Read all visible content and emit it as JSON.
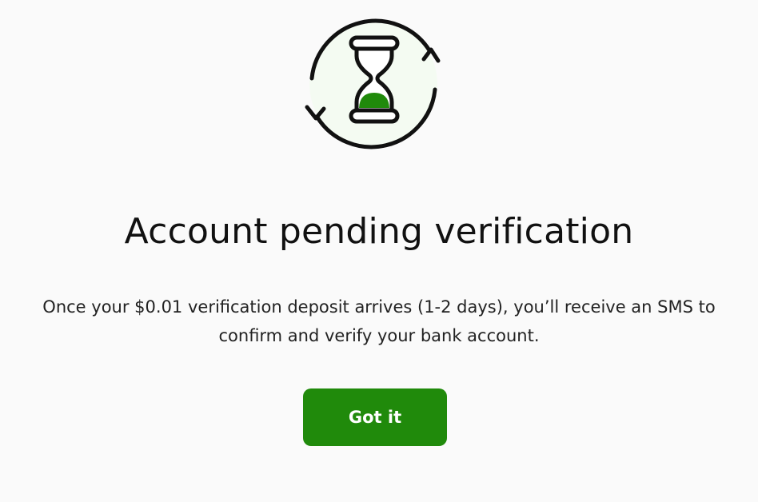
{
  "illustration": {
    "icon": "hourglass-refresh-icon",
    "accent_color": "#208a0b",
    "circle_fill": "#f4fbf2"
  },
  "title": "Account pending verification",
  "message": "Once your $0.01 verification deposit arrives (1-2 days), you’ll receive an SMS to confirm and verify your bank account.",
  "primary_button": {
    "label": "Got it",
    "color": "#208a0b"
  }
}
